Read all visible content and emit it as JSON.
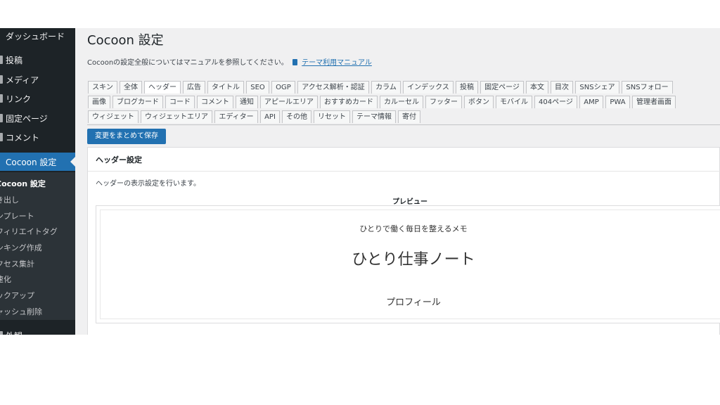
{
  "sidebar": {
    "menu": [
      {
        "label": "ダッシュボード",
        "icon": "dashboard-icon"
      },
      {
        "label": "投稿",
        "icon": "pin-icon"
      },
      {
        "label": "メディア",
        "icon": "media-icon"
      },
      {
        "label": "リンク",
        "icon": "link-icon"
      },
      {
        "label": "固定ページ",
        "icon": "page-icon"
      },
      {
        "label": "コメント",
        "icon": "comment-icon"
      }
    ],
    "active": {
      "label": "Cocoon 設定",
      "icon": "cocoon-icon"
    },
    "submenu": [
      "Cocoon 設定",
      "き出し",
      "ンプレート",
      "フィリエイトタグ",
      "ンキング作成",
      "クセス集計",
      "速化",
      "ックアップ",
      "ャッシュ削除"
    ],
    "next_menu": "外観"
  },
  "header": {
    "title": "Cocoon 設定",
    "intro_text": "Cocoonの設定全般についてはマニュアルを参照してください。",
    "manual_link": "テーマ利用マニュアル"
  },
  "tabs": {
    "row1": [
      "スキン",
      "全体",
      "ヘッダー",
      "広告",
      "タイトル",
      "SEO",
      "OGP",
      "アクセス解析・認証",
      "カラム",
      "インデックス",
      "投稿",
      "固定ページ",
      "本文",
      "目次",
      "SNSシェア",
      "SNSフォロー"
    ],
    "row2": [
      "画像",
      "ブログカード",
      "コード",
      "コメント",
      "通知",
      "アピールエリア",
      "おすすめカード",
      "カルーセル",
      "フッター",
      "ボタン",
      "モバイル",
      "404ページ",
      "AMP",
      "PWA",
      "管理者画面"
    ],
    "row3": [
      "ウィジェット",
      "ウィジェットエリア",
      "エディター",
      "API",
      "その他",
      "リセット",
      "テーマ情報",
      "寄付"
    ],
    "active": "ヘッダー"
  },
  "save_button": "変更をまとめて保存",
  "panel": {
    "title": "ヘッダー設定",
    "description": "ヘッダーの表示設定を行います。",
    "preview_label": "プレビュー",
    "preview": {
      "tagline": "ひとりで働く毎日を整えるメモ",
      "site_name": "ひとり仕事ノート",
      "profile": "プロフィール"
    }
  },
  "colors": {
    "sidebar_bg": "#1d2327",
    "submenu_bg": "#2c3338",
    "accent": "#2271b1",
    "content_bg": "#f0f0f1"
  }
}
